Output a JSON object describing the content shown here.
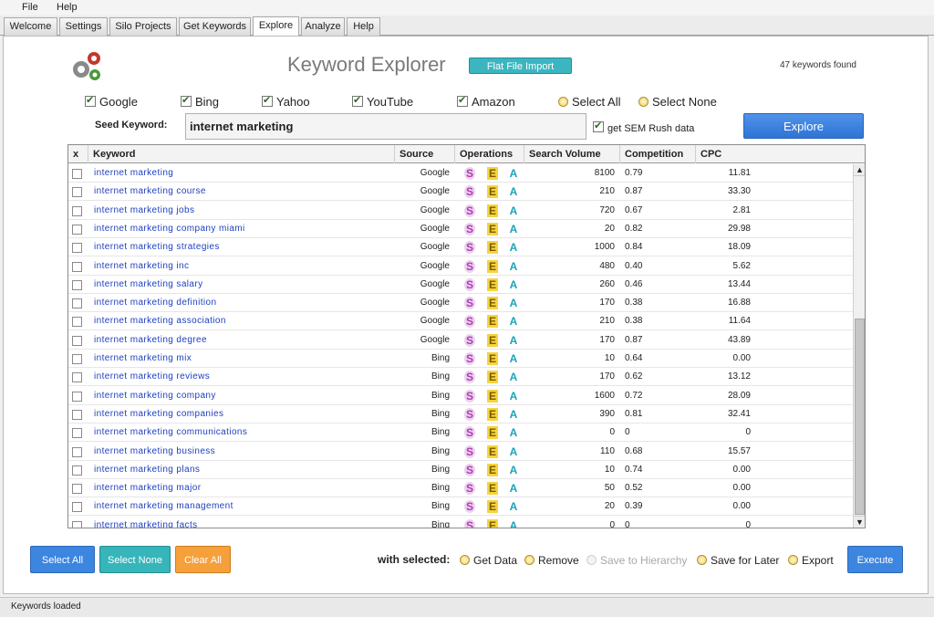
{
  "menu": [
    "File",
    "Help"
  ],
  "tabs": [
    "Welcome",
    "Settings",
    "Silo Projects",
    "Get Keywords",
    "Explore",
    "Analyze",
    "Help"
  ],
  "active_tab": "Explore",
  "header": {
    "title": "Keyword Explorer",
    "flat_file_button": "Flat File Import",
    "found_text": "47 keywords found"
  },
  "sources": [
    {
      "label": "Google",
      "checked": true
    },
    {
      "label": "Bing",
      "checked": true
    },
    {
      "label": "Yahoo",
      "checked": true
    },
    {
      "label": "YouTube",
      "checked": true
    },
    {
      "label": "Amazon",
      "checked": true
    }
  ],
  "select_all_radio": "Select All",
  "select_none_radio": "Select None",
  "seed": {
    "label": "Seed Keyword:",
    "value": "internet marketing",
    "sem_label": "get SEM Rush data",
    "sem_checked": true,
    "explore_button": "Explore"
  },
  "table": {
    "columns": [
      "x",
      "Keyword",
      "Source",
      "Operations",
      "Search Volume",
      "Competition",
      "CPC"
    ],
    "op_icons": [
      "S",
      "E",
      "A"
    ],
    "rows": [
      {
        "keyword": "internet marketing",
        "source": "Google",
        "volume": "8100",
        "competition": "0.79",
        "cpc": "11.81"
      },
      {
        "keyword": "internet marketing course",
        "source": "Google",
        "volume": "210",
        "competition": "0.87",
        "cpc": "33.30"
      },
      {
        "keyword": "internet marketing jobs",
        "source": "Google",
        "volume": "720",
        "competition": "0.67",
        "cpc": "2.81"
      },
      {
        "keyword": "internet marketing company miami",
        "source": "Google",
        "volume": "20",
        "competition": "0.82",
        "cpc": "29.98"
      },
      {
        "keyword": "internet marketing strategies",
        "source": "Google",
        "volume": "1000",
        "competition": "0.84",
        "cpc": "18.09"
      },
      {
        "keyword": "internet marketing inc",
        "source": "Google",
        "volume": "480",
        "competition": "0.40",
        "cpc": "5.62"
      },
      {
        "keyword": "internet marketing salary",
        "source": "Google",
        "volume": "260",
        "competition": "0.46",
        "cpc": "13.44"
      },
      {
        "keyword": "internet marketing definition",
        "source": "Google",
        "volume": "170",
        "competition": "0.38",
        "cpc": "16.88"
      },
      {
        "keyword": "internet marketing association",
        "source": "Google",
        "volume": "210",
        "competition": "0.38",
        "cpc": "11.64"
      },
      {
        "keyword": "internet marketing degree",
        "source": "Google",
        "volume": "170",
        "competition": "0.87",
        "cpc": "43.89"
      },
      {
        "keyword": "internet marketing mix",
        "source": "Bing",
        "volume": "10",
        "competition": "0.64",
        "cpc": "0.00"
      },
      {
        "keyword": "internet marketing reviews",
        "source": "Bing",
        "volume": "170",
        "competition": "0.62",
        "cpc": "13.12"
      },
      {
        "keyword": "internet marketing company",
        "source": "Bing",
        "volume": "1600",
        "competition": "0.72",
        "cpc": "28.09"
      },
      {
        "keyword": "internet marketing companies",
        "source": "Bing",
        "volume": "390",
        "competition": "0.81",
        "cpc": "32.41"
      },
      {
        "keyword": "internet marketing communications",
        "source": "Bing",
        "volume": "0",
        "competition": "0",
        "cpc": "0"
      },
      {
        "keyword": "internet marketing business",
        "source": "Bing",
        "volume": "110",
        "competition": "0.68",
        "cpc": "15.57"
      },
      {
        "keyword": "internet marketing plans",
        "source": "Bing",
        "volume": "10",
        "competition": "0.74",
        "cpc": "0.00"
      },
      {
        "keyword": "internet marketing major",
        "source": "Bing",
        "volume": "50",
        "competition": "0.52",
        "cpc": "0.00"
      },
      {
        "keyword": "internet marketing management",
        "source": "Bing",
        "volume": "20",
        "competition": "0.39",
        "cpc": "0.00"
      },
      {
        "keyword": "internet marketing facts",
        "source": "Bing",
        "volume": "0",
        "competition": "0",
        "cpc": "0"
      }
    ]
  },
  "bottom": {
    "select_all": "Select All",
    "select_none": "Select None",
    "clear_all": "Clear All",
    "with_selected": "with selected:",
    "actions": [
      {
        "label": "Get Data",
        "disabled": false
      },
      {
        "label": "Remove",
        "disabled": false
      },
      {
        "label": "Save to Hierarchy",
        "disabled": true
      },
      {
        "label": "Save for Later",
        "disabled": false
      },
      {
        "label": "Export",
        "disabled": false
      }
    ],
    "execute": "Execute"
  },
  "status": "Keywords loaded"
}
